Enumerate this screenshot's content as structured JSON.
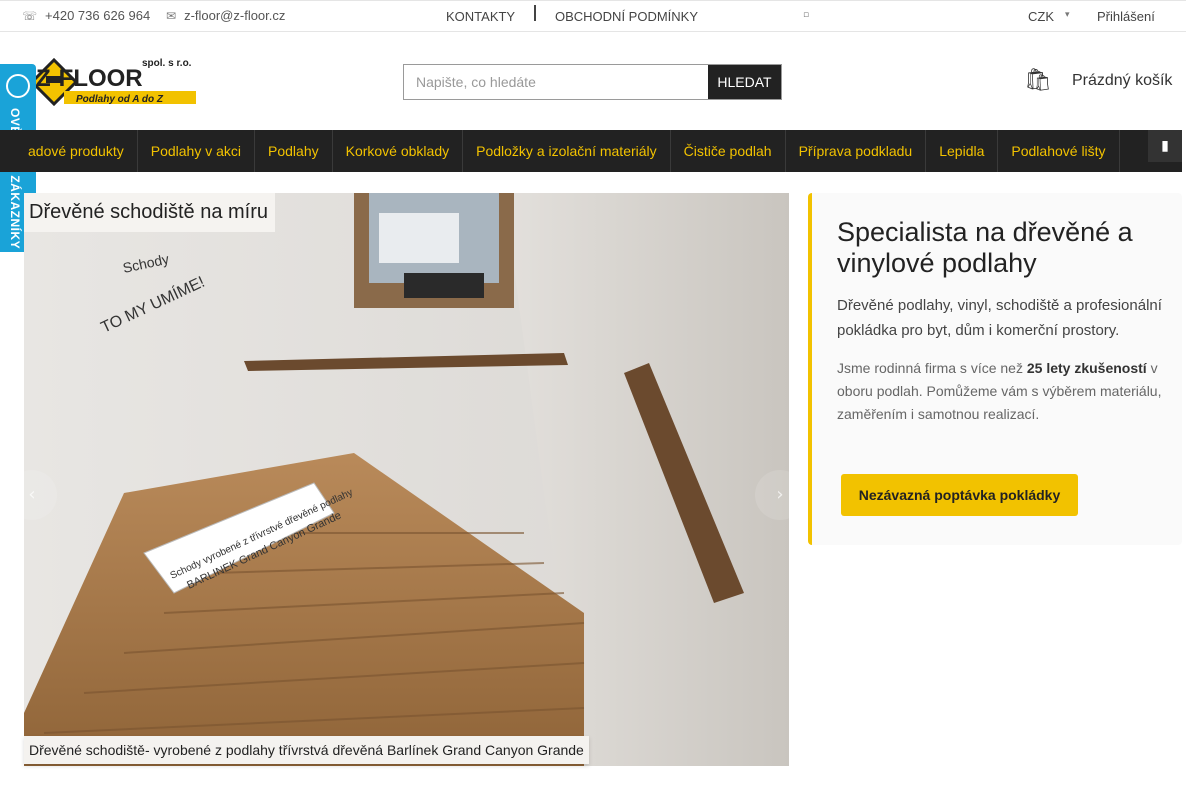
{
  "topbar": {
    "phone": "+420 736 626 964",
    "email": "z-floor@z-floor.cz",
    "links": [
      "KONTAKTY",
      "OBCHODNÍ PODMÍNKY"
    ],
    "currency": "CZK",
    "login": "Přihlášení"
  },
  "header": {
    "logo_text": "Z-FLOOR",
    "logo_suffix": "spol. s r.o.",
    "logo_tagline": "Podlahy od A do Z",
    "search_placeholder": "Napište, co hledáte",
    "search_button": "HLEDAT",
    "cart_label": "Prázdný košík"
  },
  "badge": {
    "label": "OVĚŘENO ZÁKAZNÍKY"
  },
  "menu": {
    "items": [
      "adové produkty",
      "Podlahy v akci",
      "Podlahy",
      "Korkové obklady",
      "Podložky a izolační materiály",
      "Čističe podlah",
      "Příprava podkladu",
      "Lepidla",
      "Podlahové lišty"
    ]
  },
  "slider": {
    "title": "Dřevěné schodiště na míru",
    "caption": "Dřevěné schodiště- vyrobené z podlahy třívrstvá dřevěná Barlínek Grand Canyon Grande",
    "wall_text_1": "Schody",
    "wall_text_2": "TO MY UMÍME!",
    "tread_text_1": "Schody vyrobené z třívrstvé dřevěné podlahy",
    "tread_text_2": "BARLINEK Grand Canyon Grande"
  },
  "info": {
    "title": "Specialista na dřevěné a vinylové podlahy",
    "lead": "Dřevěné podlahy, vinyl, schodiště a profesionální pokládka pro byt, dům i komerční prostory.",
    "body_1": "Jsme rodinná firma s více než ",
    "body_strong": "25 lety zkušeností",
    "body_2": " v oboru podlah. Pomůžeme vám s výběrem materiálu, zaměřením i samotnou realizací.",
    "cta": "Nezávazná poptávka pokládky"
  },
  "colors": {
    "accent": "#f2c200",
    "menu_bg": "#222222",
    "badge": "#1aa3d8"
  }
}
